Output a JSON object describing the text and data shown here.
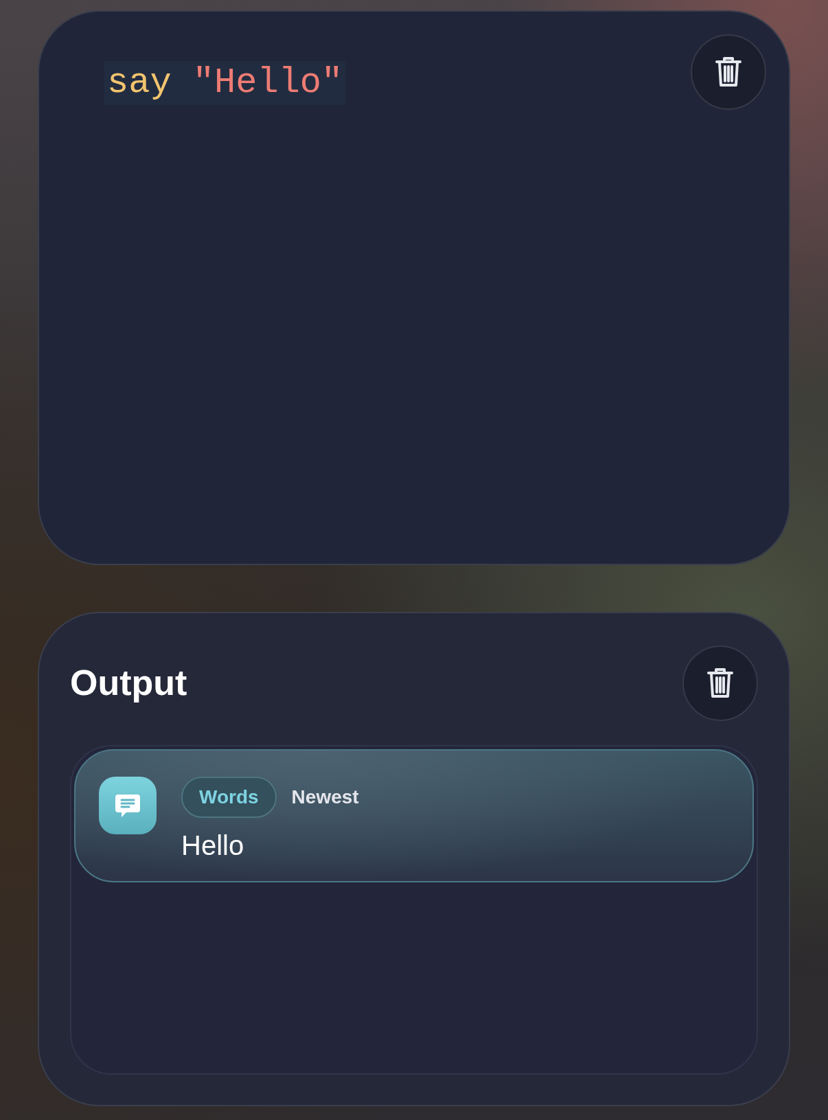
{
  "editor": {
    "code": [
      {
        "kind": "keyword",
        "text": "say"
      },
      {
        "kind": "string",
        "text": "\"Hello\""
      }
    ]
  },
  "output": {
    "title": "Output",
    "messages": [
      {
        "kind": "words",
        "tag": "Words",
        "badge": "Newest",
        "text": "Hello"
      }
    ]
  }
}
